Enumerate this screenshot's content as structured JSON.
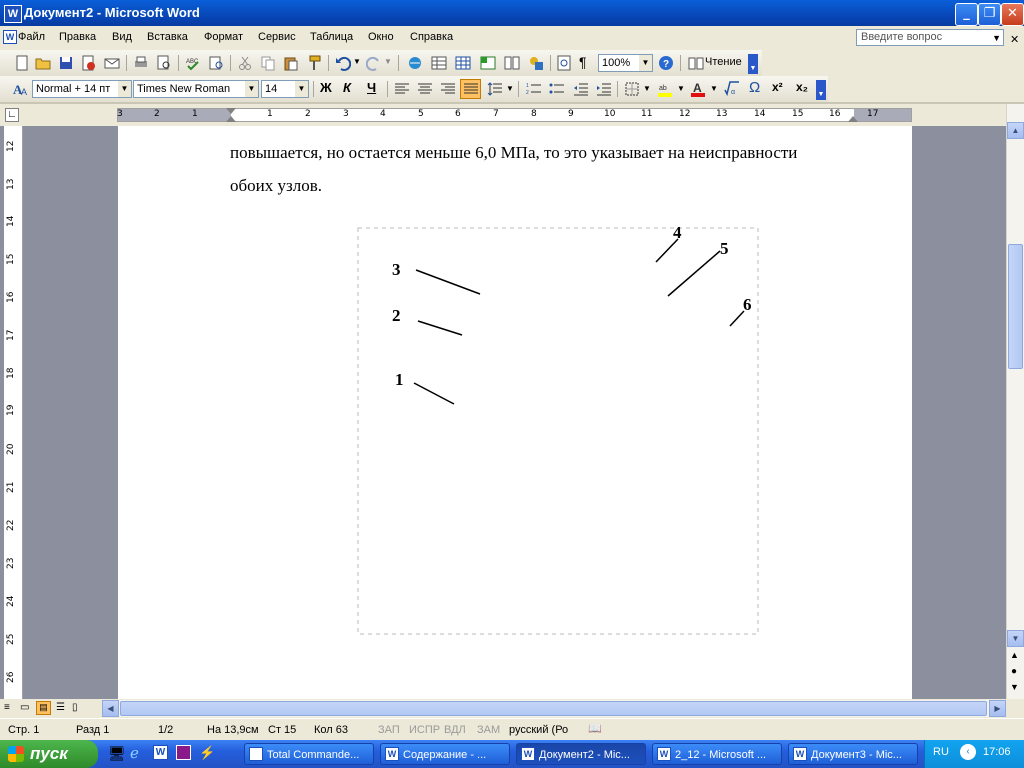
{
  "window": {
    "title": "Документ2 - Microsoft Word",
    "minimize_glyph": "_",
    "maximize_glyph": "❐",
    "close_glyph": "✕"
  },
  "menu": {
    "items": [
      "Файл",
      "Правка",
      "Вид",
      "Вставка",
      "Формат",
      "Сервис",
      "Таблица",
      "Окно",
      "Справка"
    ],
    "help_placeholder": "Введите вопрос"
  },
  "standard_toolbar": {
    "zoom": "100%",
    "reading_label": "Чтение",
    "pilcrow": "¶"
  },
  "format_toolbar": {
    "style": "Normal + 14 пт",
    "font": "Times New Roman",
    "size": "14",
    "bold": "Ж",
    "italic": "К",
    "underline": "Ч",
    "omega": "Ω",
    "superscript": "x²",
    "subscript": "x₂"
  },
  "ruler": {
    "numbers": [
      "3",
      "2",
      "1",
      "1",
      "2",
      "3",
      "4",
      "5",
      "6",
      "7",
      "8",
      "9",
      "10",
      "11",
      "12",
      "13",
      "14",
      "15",
      "16",
      "17"
    ]
  },
  "vertical_ruler": {
    "numbers": [
      "12",
      "13",
      "14",
      "15",
      "16",
      "17",
      "18",
      "19",
      "20",
      "21",
      "22",
      "23",
      "24",
      "25",
      "26"
    ]
  },
  "document": {
    "line1": "повышается, но остается меньше 6,0 МПа, то это указывает на неисправности",
    "line2": "обоих узлов.",
    "figure_callouts": [
      "1",
      "2",
      "3",
      "4",
      "5",
      "6"
    ]
  },
  "status": {
    "page": "Стр. 1",
    "section": "Разд 1",
    "pages": "1/2",
    "at": "На 13,9см",
    "line": "Ст 15",
    "col": "Кол 63",
    "rec": "ЗАП",
    "trk": "ИСПР",
    "ext": "ВДЛ",
    "ovr": "ЗАМ",
    "language": "русский (Ро"
  },
  "taskbar": {
    "start": "пуск",
    "buttons": [
      "Total Commande...",
      "Содержание - ...",
      "Документ2 - Mic...",
      "2_12 - Microsoft ...",
      "Документ3 - Mic..."
    ],
    "active_index": 2,
    "lang": "RU",
    "clock": "17:06"
  }
}
